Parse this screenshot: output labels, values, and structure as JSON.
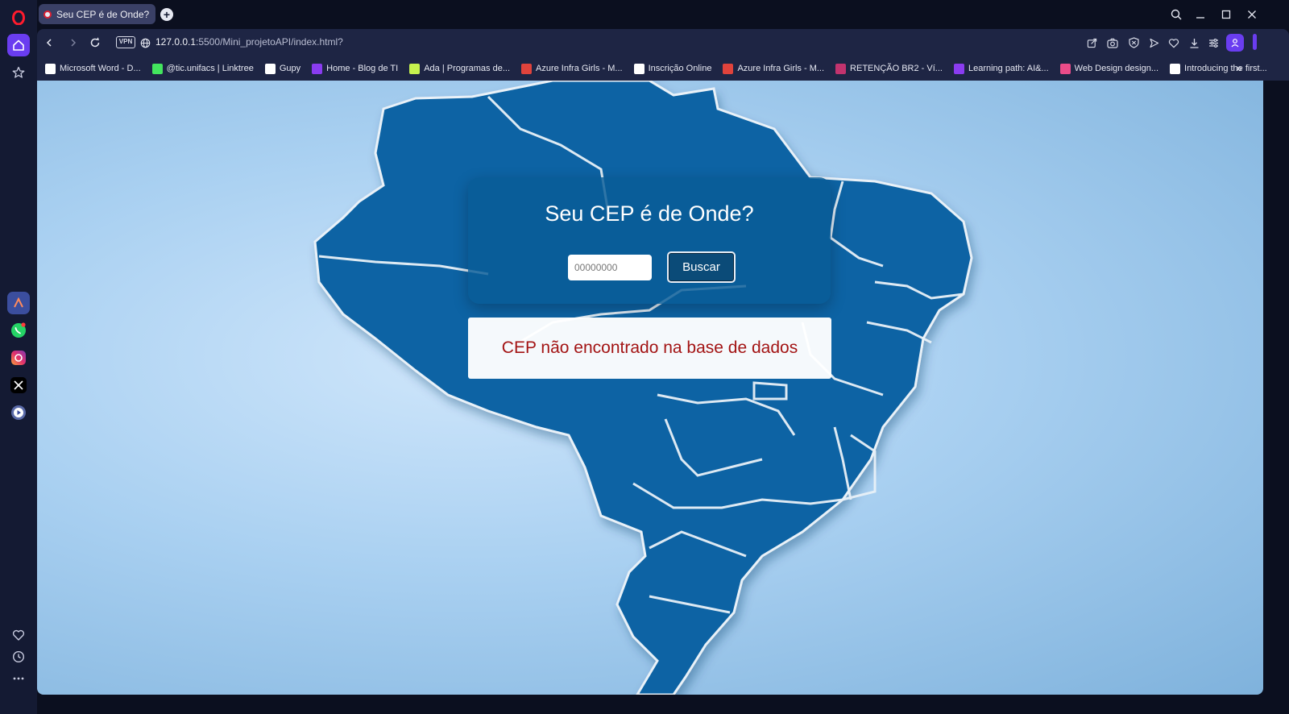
{
  "browser": {
    "tab_title": "Seu CEP é de Onde?",
    "url_host": "127.0.0.1",
    "url_path": ":5500/Mini_projetoAPI/index.html?",
    "vpn_label": "VPN",
    "accent_color": "#6a3df0"
  },
  "bookmarks": [
    {
      "label": "Microsoft Word - D...",
      "icon": "notion-icon",
      "color": "#ffffff"
    },
    {
      "label": "@tic.unifacs | Linktree",
      "icon": "linktree-icon",
      "color": "#43e55e"
    },
    {
      "label": "Gupy",
      "icon": "gupy-icon",
      "color": "#ffffff"
    },
    {
      "label": "Home - Blog de TI",
      "icon": "blog-icon",
      "color": "#8a3cf0"
    },
    {
      "label": "Ada | Programas de...",
      "icon": "ada-icon",
      "color": "#c6f24e"
    },
    {
      "label": "Azure Infra Girls - M...",
      "icon": "azure-girls-icon",
      "color": "#e0433c"
    },
    {
      "label": "Inscrição Online",
      "icon": "document-icon",
      "color": "#ffffff"
    },
    {
      "label": "Azure Infra Girls - M...",
      "icon": "azure-girls-icon",
      "color": "#e0433c"
    },
    {
      "label": "RETENÇÃO BR2 - Ví...",
      "icon": "retencao-icon",
      "color": "#c2336e"
    },
    {
      "label": "Learning path: AI&...",
      "icon": "learning-icon",
      "color": "#8a3cf0"
    },
    {
      "label": "Web Design design...",
      "icon": "dribbble-icon",
      "color": "#ea4c89"
    },
    {
      "label": "Introducing the first...",
      "icon": "medium-icon",
      "color": "#ffffff"
    }
  ],
  "page": {
    "title": "Seu CEP é de Onde?",
    "input_placeholder": "00000000",
    "button_label": "Buscar",
    "result_message": "CEP não encontrado na base de dados"
  },
  "colors": {
    "card_bg": "#085c96",
    "result_text": "#a31414",
    "map_fill": "#0a64a4"
  }
}
